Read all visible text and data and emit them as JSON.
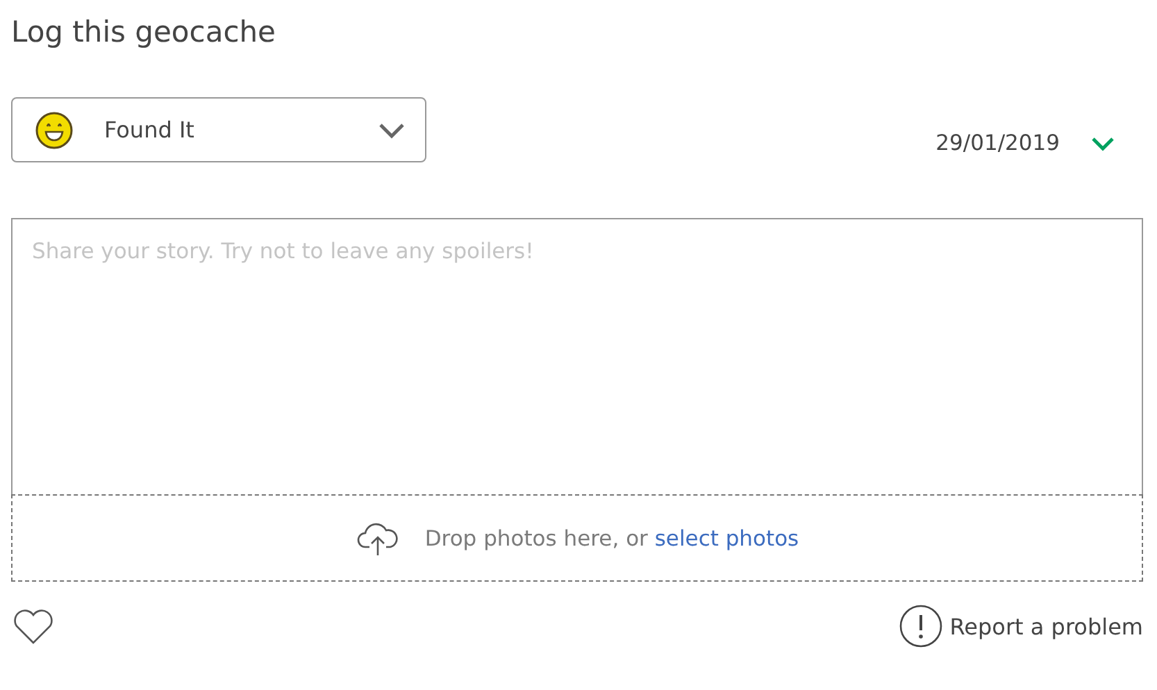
{
  "title": "Log this geocache",
  "log_type": {
    "value": "Found It"
  },
  "date": {
    "value": "29/01/2019"
  },
  "story": {
    "placeholder": "Share your story. Try not to leave any spoilers!"
  },
  "photo_drop": {
    "text": "Drop photos here, or",
    "link": "select photos"
  },
  "favorite": {
    "selected": false
  },
  "report": {
    "label": "Report a problem"
  }
}
